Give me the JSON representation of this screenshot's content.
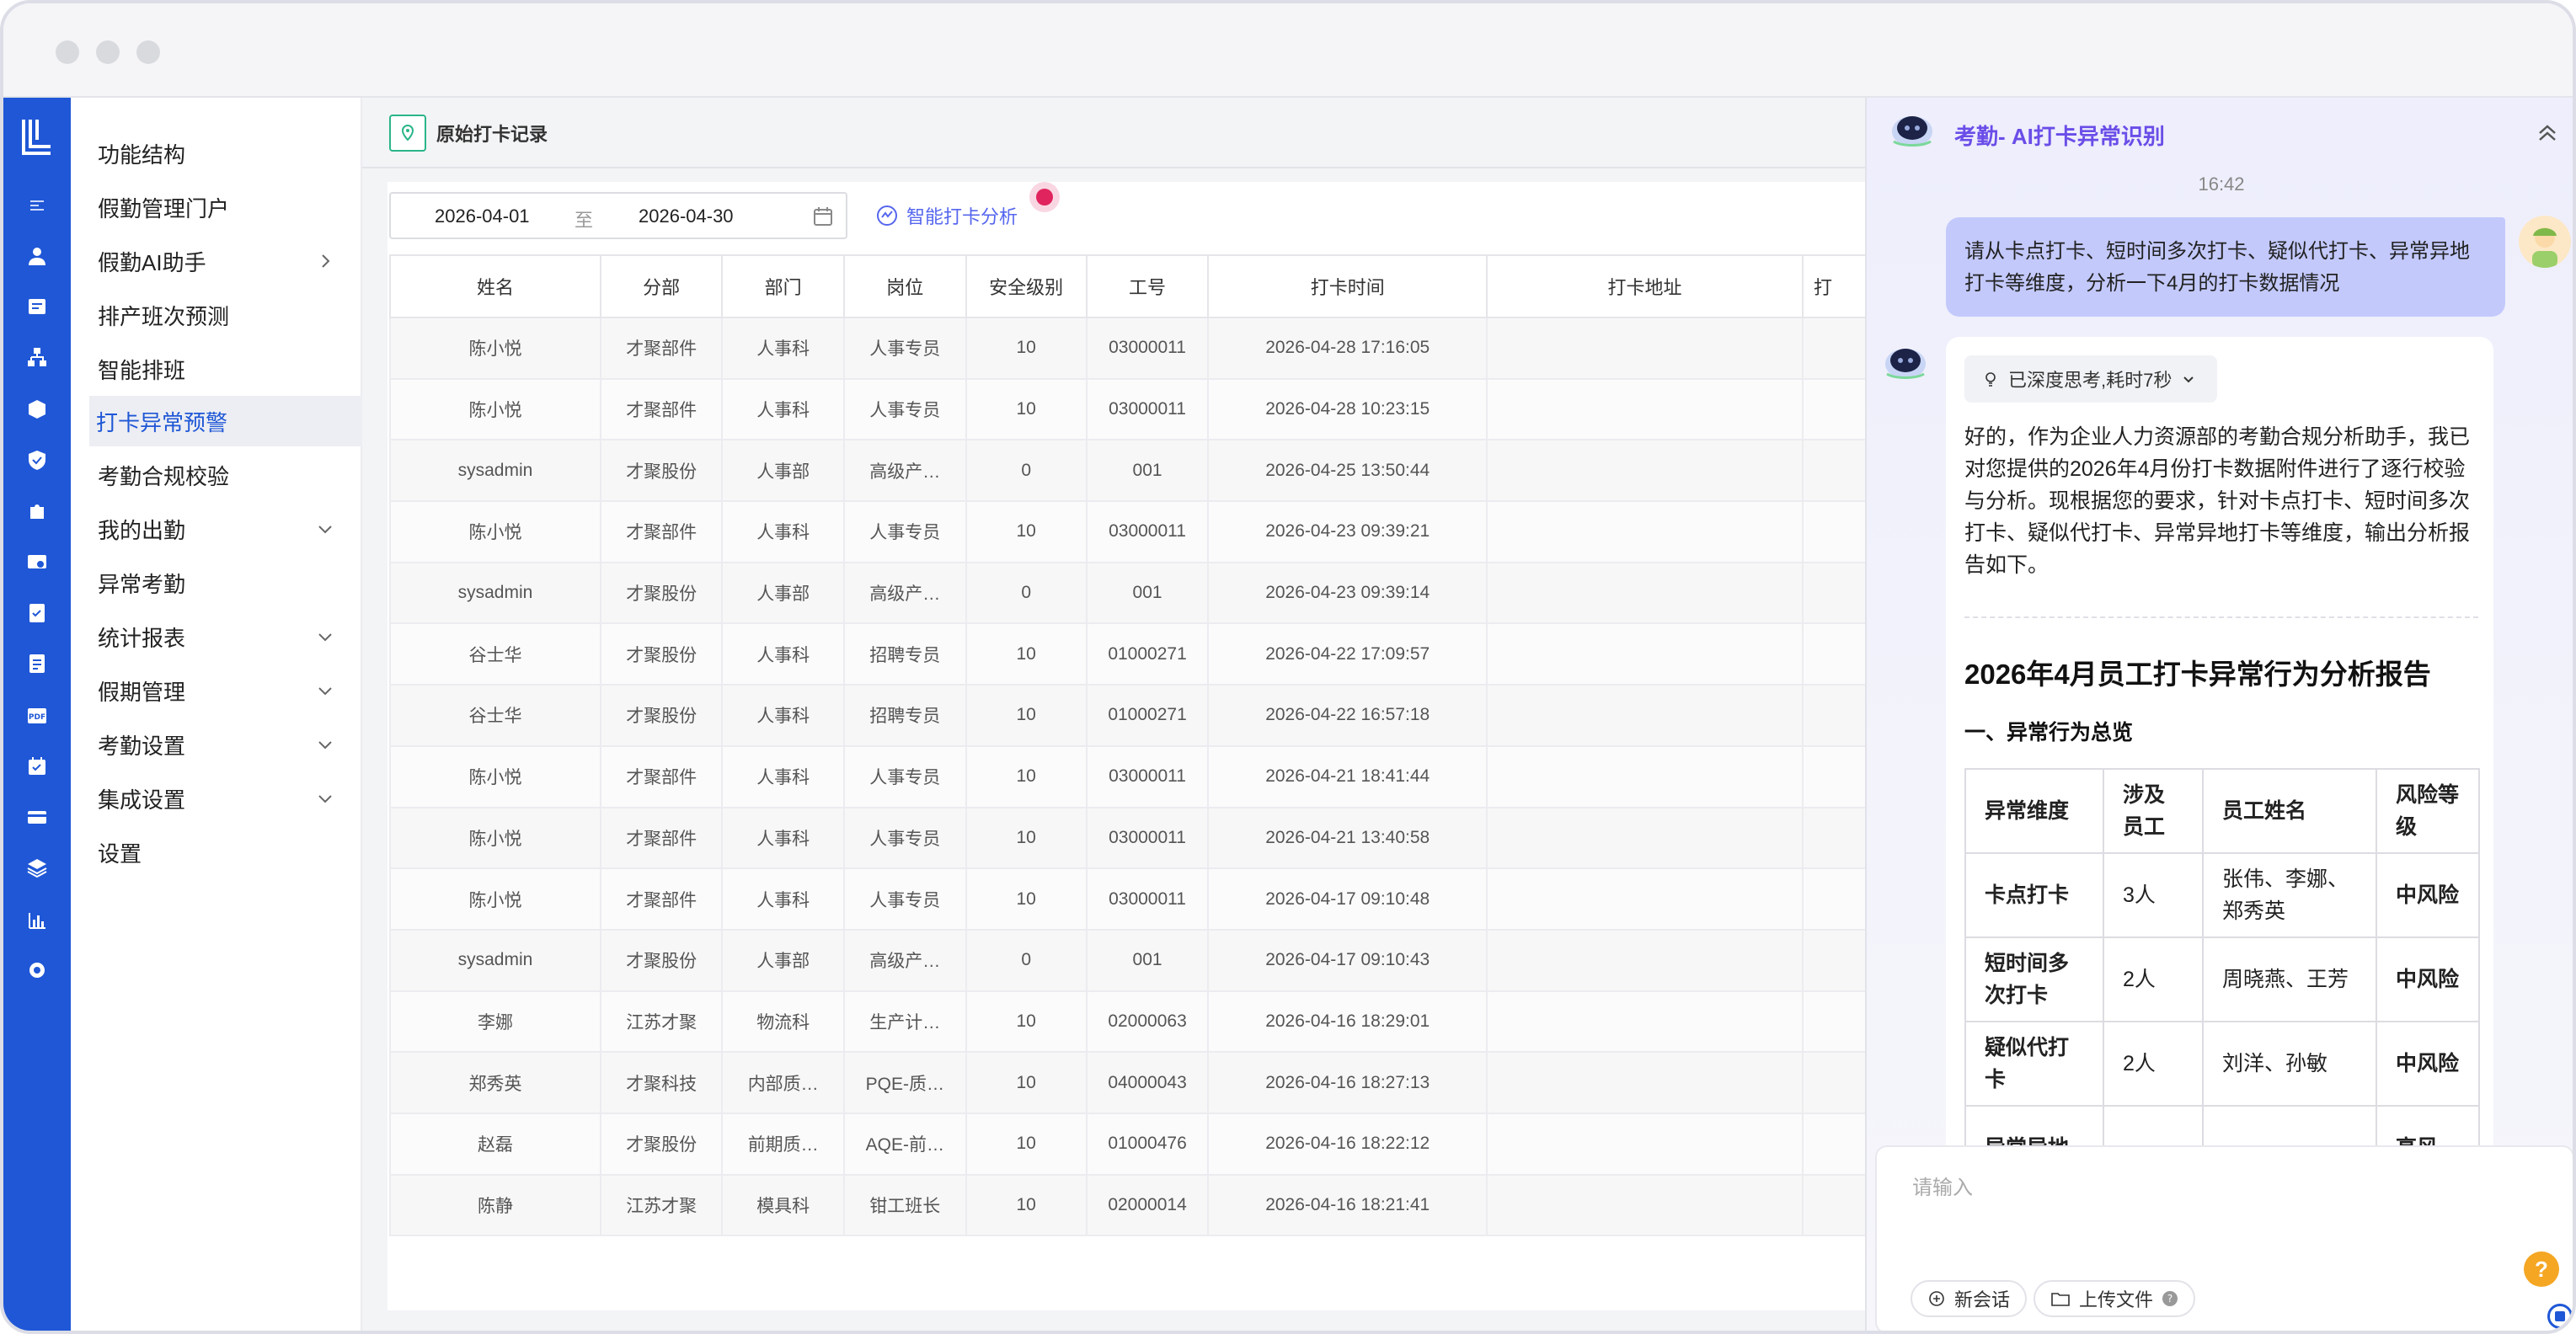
{
  "menu": {
    "items": [
      {
        "label": "功能结构",
        "chevron": ""
      },
      {
        "label": "假勤管理门户",
        "chevron": ""
      },
      {
        "label": "假勤AI助手",
        "chevron": "right"
      },
      {
        "label": "排产班次预测",
        "chevron": ""
      },
      {
        "label": "智能排班",
        "chevron": ""
      },
      {
        "label": "打卡异常预警",
        "chevron": "",
        "active": true
      },
      {
        "label": "考勤合规校验",
        "chevron": ""
      },
      {
        "label": "我的出勤",
        "chevron": "down"
      },
      {
        "label": "异常考勤",
        "chevron": ""
      },
      {
        "label": "统计报表",
        "chevron": "down"
      },
      {
        "label": "假期管理",
        "chevron": "down"
      },
      {
        "label": "考勤设置",
        "chevron": "down"
      },
      {
        "label": "集成设置",
        "chevron": "down"
      },
      {
        "label": "设置",
        "chevron": ""
      }
    ]
  },
  "page": {
    "title": "原始打卡记录",
    "date_start": "2026-04-01",
    "date_sep": "至",
    "date_end": "2026-04-30",
    "smart_button": "智能打卡分析"
  },
  "table": {
    "headers": [
      "姓名",
      "分部",
      "部门",
      "岗位",
      "安全级别",
      "工号",
      "打卡时间",
      "打卡地址",
      "打"
    ],
    "rows": [
      [
        "陈小悦",
        "才聚部件",
        "人事科",
        "人事专员",
        "10",
        "03000011",
        "2026-04-28 17:16:05",
        "",
        ""
      ],
      [
        "陈小悦",
        "才聚部件",
        "人事科",
        "人事专员",
        "10",
        "03000011",
        "2026-04-28 10:23:15",
        "",
        ""
      ],
      [
        "sysadmin",
        "才聚股份",
        "人事部",
        "高级产…",
        "0",
        "001",
        "2026-04-25 13:50:44",
        "",
        ""
      ],
      [
        "陈小悦",
        "才聚部件",
        "人事科",
        "人事专员",
        "10",
        "03000011",
        "2026-04-23 09:39:21",
        "",
        ""
      ],
      [
        "sysadmin",
        "才聚股份",
        "人事部",
        "高级产…",
        "0",
        "001",
        "2026-04-23 09:39:14",
        "",
        ""
      ],
      [
        "谷士华",
        "才聚股份",
        "人事科",
        "招聘专员",
        "10",
        "01000271",
        "2026-04-22 17:09:57",
        "",
        ""
      ],
      [
        "谷士华",
        "才聚股份",
        "人事科",
        "招聘专员",
        "10",
        "01000271",
        "2026-04-22 16:57:18",
        "",
        ""
      ],
      [
        "陈小悦",
        "才聚部件",
        "人事科",
        "人事专员",
        "10",
        "03000011",
        "2026-04-21 18:41:44",
        "",
        ""
      ],
      [
        "陈小悦",
        "才聚部件",
        "人事科",
        "人事专员",
        "10",
        "03000011",
        "2026-04-21 13:40:58",
        "",
        ""
      ],
      [
        "陈小悦",
        "才聚部件",
        "人事科",
        "人事专员",
        "10",
        "03000011",
        "2026-04-17 09:10:48",
        "",
        ""
      ],
      [
        "sysadmin",
        "才聚股份",
        "人事部",
        "高级产…",
        "0",
        "001",
        "2026-04-17 09:10:43",
        "",
        ""
      ],
      [
        "李娜",
        "江苏才聚",
        "物流科",
        "生产计…",
        "10",
        "02000063",
        "2026-04-16 18:29:01",
        "",
        ""
      ],
      [
        "郑秀英",
        "才聚科技",
        "内部质…",
        "PQE-质…",
        "10",
        "04000043",
        "2026-04-16 18:27:13",
        "",
        ""
      ],
      [
        "赵磊",
        "才聚股份",
        "前期质…",
        "AQE-前…",
        "10",
        "01000476",
        "2026-04-16 18:22:12",
        "",
        ""
      ],
      [
        "陈静",
        "江苏才聚",
        "模具科",
        "钳工班长",
        "10",
        "02000014",
        "2026-04-16 18:21:41",
        "",
        ""
      ]
    ]
  },
  "chat": {
    "title": "考勤- AI打卡异常识别",
    "time": "16:42",
    "user_message": "请从卡点打卡、短时间多次打卡、疑似代打卡、异常异地打卡等维度，分析一下4月的打卡数据情况",
    "think_label": "已深度思考,耗时7秒",
    "ai_intro": "好的，作为企业人力资源部的考勤合规分析助手，我已对您提供的2026年4月份打卡数据附件进行了逐行校验与分析。现根据您的要求，针对卡点打卡、短时间多次打卡、疑似代打卡、异常异地打卡等维度，输出分析报告如下。",
    "report_title": "2026年4月员工打卡异常行为分析报告",
    "section_title": "一、异常行为总览",
    "risk_headers": [
      "异常维度",
      "涉及员工",
      "员工姓名",
      "风险等级"
    ],
    "risk_rows": [
      [
        "卡点打卡",
        "3人",
        "张伟、李娜、郑秀英",
        "中风险"
      ],
      [
        "短时间多次打卡",
        "2人",
        "周晓燕、王芳",
        "中风险"
      ],
      [
        "疑似代打卡",
        "2人",
        "刘洋、孙敏",
        "中风险"
      ],
      [
        "异常异地",
        "",
        "",
        "高风"
      ]
    ],
    "input_placeholder": "请输入",
    "new_chat": "新会话",
    "upload": "上传文件",
    "help": "?"
  },
  "colors": {
    "brand": "#1f57d6",
    "active_menu": "#1f57d6",
    "chat_title": "#6a4de8",
    "user_bubble": "#c3c9fb",
    "notification_dot": "#e0245e"
  }
}
